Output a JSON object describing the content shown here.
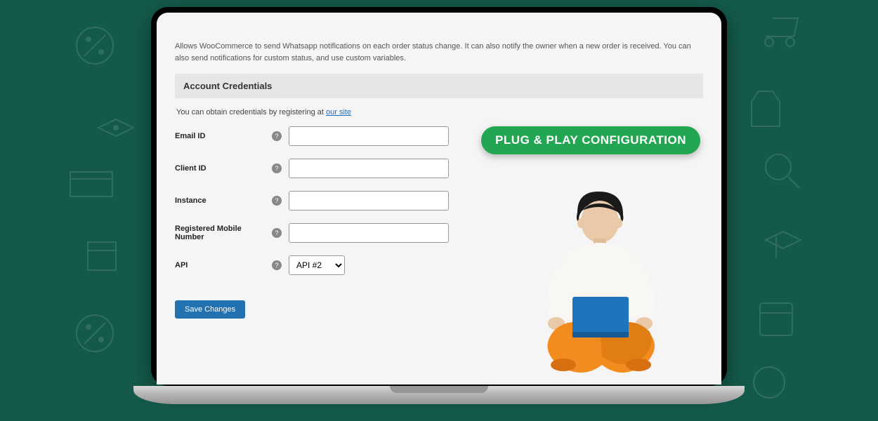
{
  "meta": {
    "description": "Allows WooCommerce to send Whatsapp notifications on each order status change. It can also notify the owner when a new order is received. You can also send notifications for custom status, and use custom variables."
  },
  "section": {
    "title": "Account Credentials",
    "subnote_prefix": "You can obtain credentials by registering at ",
    "subnote_link": "our site"
  },
  "fields": {
    "email": {
      "label": "Email ID",
      "value": ""
    },
    "client": {
      "label": "Client ID",
      "value": ""
    },
    "instance": {
      "label": "Instance",
      "value": ""
    },
    "mobile": {
      "label": "Registered Mobile Number",
      "value": ""
    },
    "api": {
      "label": "API",
      "selected": "API #2"
    }
  },
  "actions": {
    "save": "Save Changes"
  },
  "promo": {
    "badge": "PLUG & PLAY CONFIGURATION"
  },
  "colors": {
    "bg": "#145a4a",
    "badge": "#22a652",
    "primary_button": "#2271b1"
  }
}
